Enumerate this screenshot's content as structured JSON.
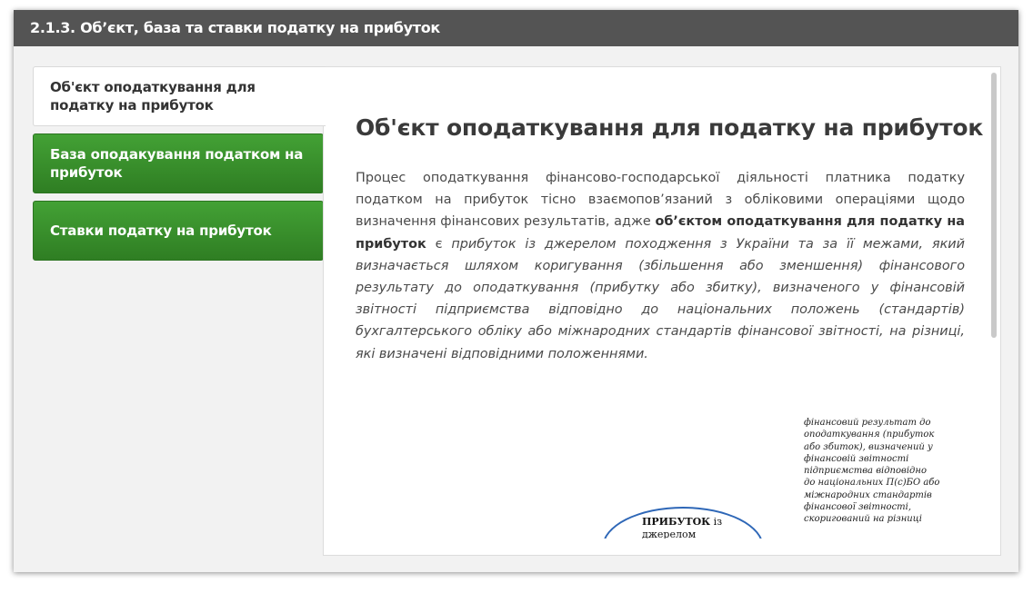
{
  "header": {
    "title": "2.1.3. Об’єкт, база та ставки податку на прибуток"
  },
  "tabs": [
    {
      "label": "Об'єкт оподаткування для податку на прибуток",
      "active": true
    },
    {
      "label": "База оподакування податком на прибуток",
      "active": false
    },
    {
      "label": "Ставки податку на прибуток",
      "active": false
    }
  ],
  "panel": {
    "title": "Об'єкт оподаткування для податку на прибуток",
    "text_part1": "Процес оподаткування фінансово-господарської діяльності платника податку податком на прибуток тісно взаємопов’язаний з обліковими операціями щодо визначення фінансових результатів, адже ",
    "text_bold": "об’єктом оподаткування для податку на прибуток",
    "text_part2": " є ",
    "text_italic": "прибуток із джерелом походження з України та за її межами, який визначається шляхом коригування (збільшення або зменшення) фінансового результату до оподаткування (прибутку або збитку), визначеного у фінансовій звітності підприємства відповідно до національних положень (стандартів) бухгалтерського обліку або міжнародних стандартів фінансової звітності, на різниці, які визначені відповідними положеннями."
  },
  "diagram": {
    "oval_bold": "ПРИБУТОК",
    "oval_rest": " із джерелом",
    "note": "фінансовий результат до оподаткування (прибуток або збиток), визначений у фінансовій звітності підприємства відповідно до національних П(с)БО або міжнародних стандартів фінансової звітності, скоригований на різниці"
  },
  "colors": {
    "header_bg": "#545454",
    "tab_green": "#3a8f2c",
    "oval_border": "#2e67b7"
  }
}
